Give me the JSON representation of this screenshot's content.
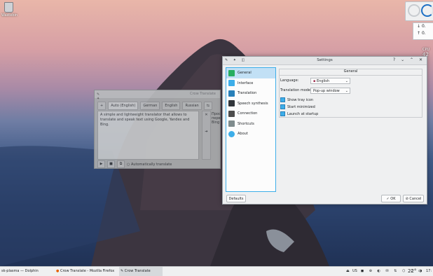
{
  "desktop": {
    "trash_label": "Wastebin"
  },
  "widgets": {
    "net_down": "0.",
    "net_up": "0.",
    "cpu_label": "CPU",
    "cpu_value": "42"
  },
  "crow": {
    "title": "Crow Translate",
    "langs": [
      "Auto (English)",
      "German",
      "English",
      "Russian"
    ],
    "source_text": "A simple and lightweight translator that allows to translate and speak text using Google, Yandex and Bing.",
    "translation_snippet": "Прос переви Bing",
    "auto_translate_label": "Automatically translate"
  },
  "settings": {
    "title": "Settings",
    "nav": [
      "General",
      "Interface",
      "Translation",
      "Speech synthesis",
      "Connection",
      "Shortcuts",
      "About"
    ],
    "section_title": "General",
    "language_label": "Language:",
    "language_value": "English",
    "translation_mode_label": "Translation mode:",
    "translation_mode_value": "Pop-up window",
    "show_tray": "Show tray icon",
    "start_min": "Start minimized",
    "launch_startup": "Launch at startup",
    "defaults_btn": "Defaults",
    "ok_btn": "OK",
    "cancel_btn": "Cancel"
  },
  "taskbar": {
    "tasks": [
      "sk-plasma — Dolphin",
      "Crow Translate - Mozilla Firefox",
      "Crow Translate"
    ],
    "keyboard": "US",
    "temp": "22°",
    "time": "17:"
  }
}
